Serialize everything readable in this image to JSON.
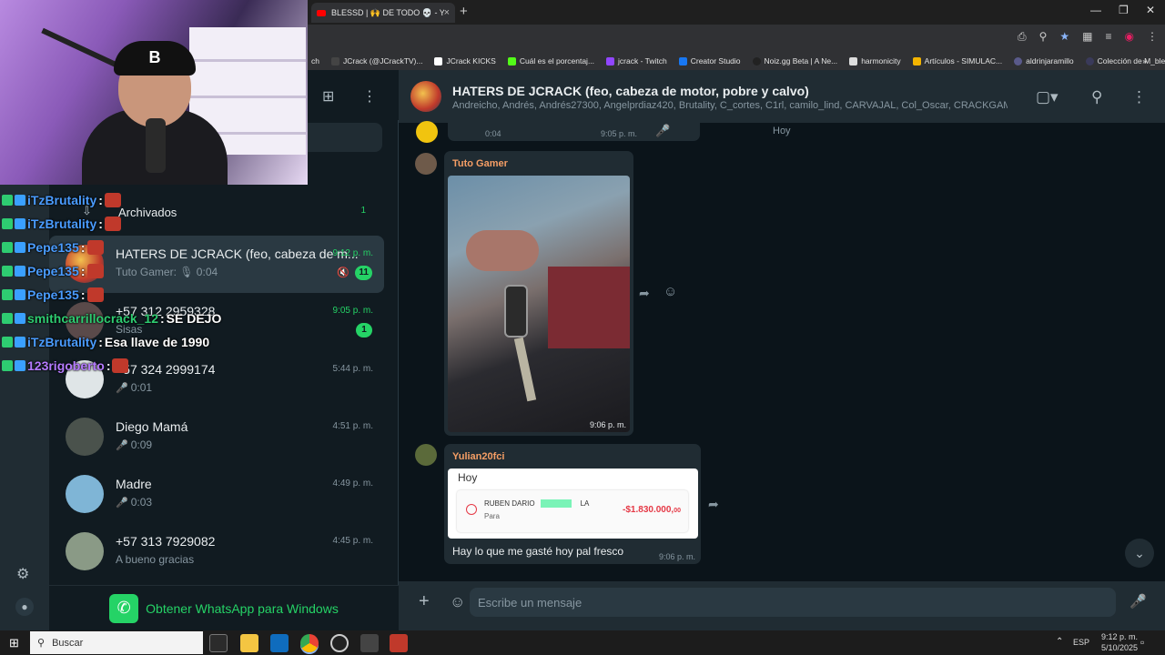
{
  "browser": {
    "tab_title": "BLESSD | 🙌 DE TODO 💀 - Yo",
    "tab_close": "×",
    "new_tab": "+",
    "bookmarks": [
      "ch",
      "JCrack (@JCrackTV)...",
      "JCrack KICKS",
      "Cuál es el porcentaj...",
      "jcrack - Twitch",
      "Creator Studio",
      "Noiz.gg Beta | A Ne...",
      "harmonicity",
      "Artículos - SIMULAC...",
      "aldrinjaramillo",
      "Colección de M_blei..."
    ],
    "bookmarks_more": "»"
  },
  "sidebar": {
    "archived_label": "Archivados",
    "archived_count": "1",
    "chats": [
      {
        "name": "HATERS DE JCRACK (feo, cabeza de m...",
        "preview": "Tuto Gamer: 🎙 0:04",
        "time": "9:12 p. m.",
        "badge": "11"
      },
      {
        "name": "+57 312 2959328",
        "preview": "Sisas",
        "time": "9:05 p. m.",
        "badge": "1"
      },
      {
        "name": "+57 324 2999174",
        "preview": "0:01",
        "time": "5:44 p. m."
      },
      {
        "name": "Diego Mamá",
        "preview": "0:09",
        "time": "4:51 p. m."
      },
      {
        "name": "Madre",
        "preview": "0:03",
        "time": "4:49 p. m."
      },
      {
        "name": "+57 313 7929082",
        "preview": "A bueno gracias",
        "time": "4:45 p. m."
      }
    ],
    "get_whatsapp": "Obtener WhatsApp para Windows"
  },
  "chat": {
    "group_name": "HATERS DE JCRACK (feo, cabeza de motor, pobre y calvo)",
    "members": "Andreicho, Andrés, Andrés27300, Angelprdiaz420, Brutality, C_cortes, C1rl, camilo_lind, CARVAJAL, Col_Oscar, CRACKGAMERT...",
    "day_label": "Hoy",
    "voice_duration": "0:04",
    "voice_time": "9:05 p. m.",
    "messages": [
      {
        "sender": "Tuto Gamer",
        "time": "9:06 p. m."
      },
      {
        "sender": "Yulian20fci",
        "text": "Hay lo que me gasté hoy pal fresco",
        "time": "9:06 p. m."
      }
    ],
    "receipt": {
      "hoy": "Hoy",
      "name": "RUBEN DARIO",
      "name_end": "LA",
      "para": "Para",
      "amount": "-$1.830.000,",
      "cents": "00"
    },
    "composer_placeholder": "Escribe un mensaje"
  },
  "stream_chat": [
    {
      "user": "iTzBrutality",
      "msg": "",
      "color": "#4a9cff"
    },
    {
      "user": "iTzBrutality",
      "msg": "",
      "color": "#4a9cff"
    },
    {
      "user": "Pepe135",
      "msg": "",
      "color": "#4a9cff"
    },
    {
      "user": "Pepe135",
      "msg": "",
      "color": "#4a9cff"
    },
    {
      "user": "Pepe135",
      "msg": "",
      "color": "#4a9cff"
    },
    {
      "user": "smithcarrillocrack_12",
      "msg": "SE DEJO",
      "color": "#2ecc71"
    },
    {
      "user": "iTzBrutality",
      "msg": "Esa llave de 1990",
      "color": "#4a9cff"
    },
    {
      "user": "123rigoberto",
      "msg": "",
      "color": "#b57bff"
    }
  ],
  "cam": {
    "cap_letter": "B"
  },
  "taskbar": {
    "search": "Buscar",
    "lang": "ESP",
    "time": "9:12 p. m.",
    "date": "5/10/2025"
  },
  "colors": {
    "accent": "#25d366",
    "panel": "#202c33",
    "bg": "#0b141a"
  }
}
